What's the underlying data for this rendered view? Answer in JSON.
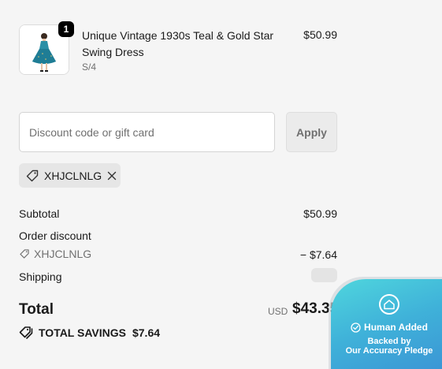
{
  "product": {
    "quantity": "1",
    "title": "Unique Vintage 1930s Teal & Gold Star Swing Dress",
    "variant": "S/4",
    "price": "$50.99",
    "image_alt": "teal swing dress"
  },
  "discount": {
    "placeholder": "Discount code or gift card",
    "value": "",
    "apply_label": "Apply",
    "applied_code": "XHJCLNLG"
  },
  "summary": {
    "subtotal_label": "Subtotal",
    "subtotal_value": "$50.99",
    "order_discount_label": "Order discount",
    "discount_code": "XHJCLNLG",
    "discount_value": "− $7.64",
    "shipping_label": "Shipping",
    "total_label": "Total",
    "currency": "USD",
    "total_value": "$43.35",
    "savings_label": "TOTAL SAVINGS",
    "savings_value": "$7.64"
  },
  "badge": {
    "title": "Human Added",
    "line1": "Backed by",
    "line2": "Our Accuracy Pledge"
  },
  "icons": {
    "tag": "tag-icon",
    "close": "close-icon",
    "check": "check-circle-icon",
    "house": "house-icon"
  },
  "colors": {
    "background": "#f5f5f5",
    "badge_teal": "#4fd6dd",
    "badge_blue": "#3a8fd4",
    "muted_text": "#707070"
  }
}
